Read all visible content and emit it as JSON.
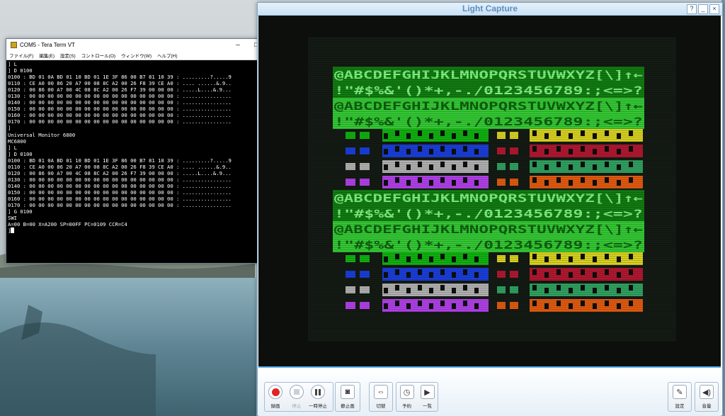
{
  "teraterm": {
    "title": "COM5 - Tera Term VT",
    "menu": [
      "ファイル(F)",
      "編集(E)",
      "設定(S)",
      "コントロール(O)",
      "ウィンドウ(W)",
      "ヘルプ(H)"
    ],
    "lines": [
      "] L",
      "] D 0100",
      "0100 : BD 01 0A BD 01 10 BD 01 1E 3F 86 00 B7 81 10 39 : .........?.....9",
      "0110 : CE A0 00 86 20 A7 00 08 8C A2 00 26 F8 39 CE A0 : .... ......&.9..",
      "0120 : 00 86 00 A7 00 4C 08 8C A2 00 26 F7 39 00 00 00 : .....L....&.9...",
      "0130 : 00 00 00 00 00 00 00 00 00 00 00 00 00 00 00 00 : ................",
      "0140 : 00 00 00 00 00 00 00 00 00 00 00 00 00 00 00 00 : ................",
      "0150 : 00 00 00 00 00 00 00 00 00 00 00 00 00 00 00 00 : ................",
      "0160 : 00 00 00 00 00 00 00 00 00 00 00 00 00 00 00 00 : ................",
      "0170 : 00 00 00 00 00 00 00 00 00 00 00 00 00 00 00 00 : ................",
      "]",
      "Universal Monitor 6800",
      "MC6800",
      "] L",
      "] D 0100",
      "0100 : BD 01 0A BD 01 10 BD 01 1E 3F 86 00 B7 81 10 39 : .........?.....9",
      "0110 : CE A0 00 86 20 A7 00 08 8C A2 00 26 F8 39 CE A0 : .... ......&.9..",
      "0120 : 00 86 00 A7 00 4C 08 8C A2 00 26 F7 39 00 00 00 : .....L....&.9...",
      "0130 : 00 00 00 00 00 00 00 00 00 00 00 00 00 00 00 00 : ................",
      "0140 : 00 00 00 00 00 00 00 00 00 00 00 00 00 00 00 00 : ................",
      "0150 : 00 00 00 00 00 00 00 00 00 00 00 00 00 00 00 00 : ................",
      "0160 : 00 00 00 00 00 00 00 00 00 00 00 00 00 00 00 00 : ................",
      "0170 : 00 00 00 00 00 00 00 00 00 00 00 00 00 00 00 00 : ................",
      "] G 0100",
      "SWI",
      "A=00 B=00 X=A200 SP=00FF PC=0109 CCR=C4",
      "]"
    ]
  },
  "capture": {
    "title": "Light Capture",
    "title_buttons": [
      "?",
      "_",
      "×"
    ],
    "screen": {
      "text_row_1": "@ABCDEFGHIJKLMNOPQRSTUVWXYZ[\\]↑←",
      "text_row_2": " !\"#$%&'()*+,-./0123456789:;<=>?",
      "colors": {
        "background": "#0c0f0c",
        "green_dark": "#127a12",
        "green_light": "#34c734",
        "text_green": "#7cf07c",
        "palette_left": [
          "#10b010",
          "#1a3ed8",
          "#b0b0b0",
          "#b040e8"
        ],
        "palette_right": [
          "#d8d020",
          "#b01830",
          "#30a060",
          "#e05a10"
        ]
      }
    },
    "toolbar": {
      "record": "録画",
      "stop": "停止",
      "pause": "一時停止",
      "still": "静止画",
      "switch": "切替",
      "schedule": "予約",
      "list": "一覧",
      "settings": "設定",
      "volume": "音量"
    }
  }
}
